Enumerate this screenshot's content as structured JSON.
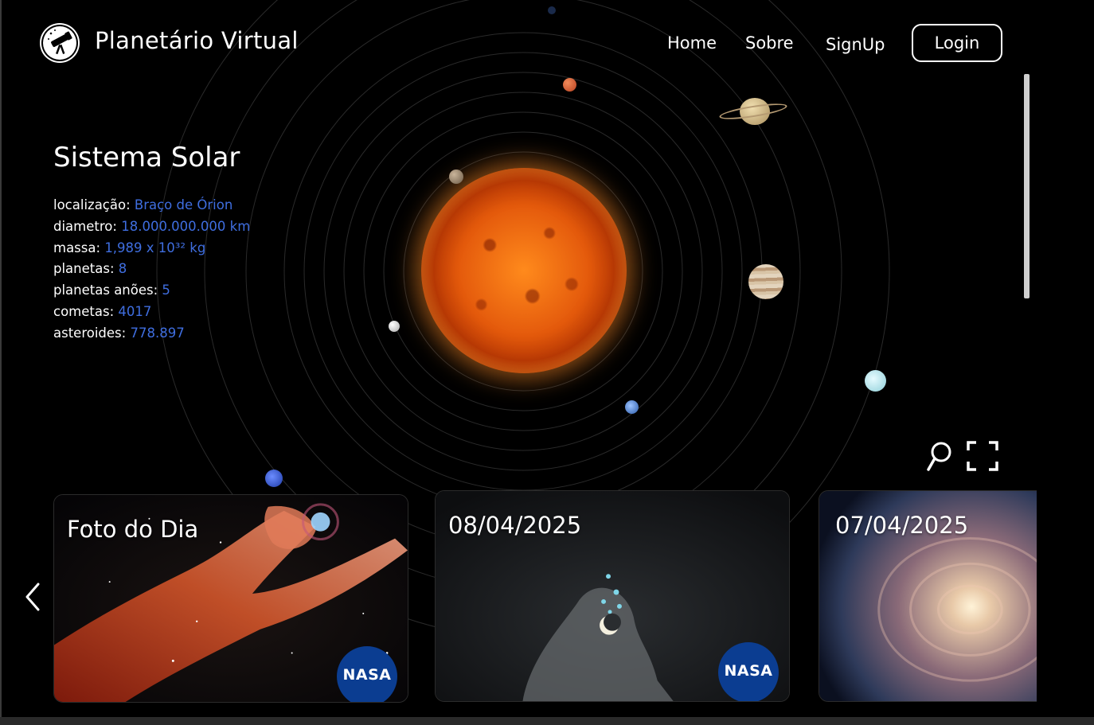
{
  "header": {
    "brand": "Planetário Virtual",
    "nav": [
      "Home",
      "Sobre",
      "SignUp"
    ],
    "login_label": "Login"
  },
  "system": {
    "title": "Sistema Solar",
    "info": [
      {
        "label": "localização:",
        "value": "Braço de Órion"
      },
      {
        "label": "diametro:",
        "value": "18.000.000.000 km"
      },
      {
        "label": "massa:",
        "value": "1,989 x 10³² kg"
      },
      {
        "label": "planetas:",
        "value": "8"
      },
      {
        "label": "planetas anões:",
        "value": "5"
      },
      {
        "label": "cometas:",
        "value": "4017"
      },
      {
        "label": "asteroides:",
        "value": "778.897"
      }
    ]
  },
  "controls": {
    "search_icon": "search-icon",
    "fullscreen_icon": "fullscreen-icon",
    "prev_icon": "chevron-left-icon"
  },
  "cards": [
    {
      "title": "Foto do Dia",
      "badge": "NASA"
    },
    {
      "title": "08/04/2025",
      "badge": "NASA"
    },
    {
      "title": "07/04/2025"
    }
  ],
  "colors": {
    "background": "#000000",
    "accent_value": "#3f6ee0",
    "text": "#ffffff"
  }
}
